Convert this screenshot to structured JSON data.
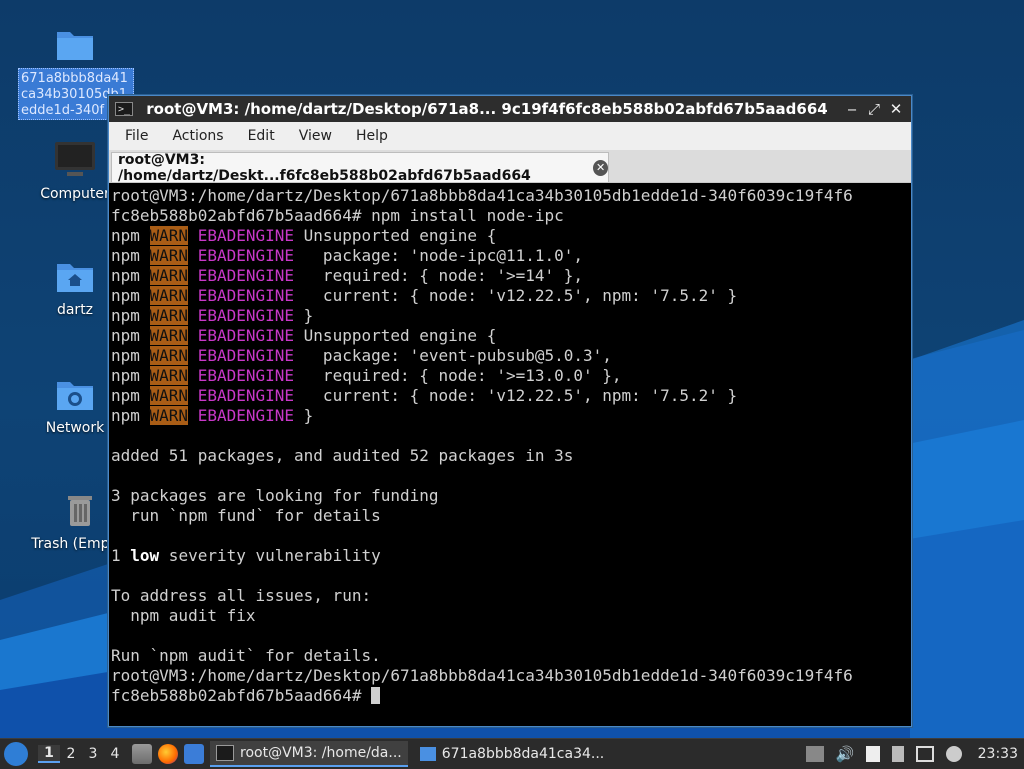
{
  "desktop": {
    "icons": [
      {
        "label": "671a8bbb8da41ca34b30105db1edde1d-340f",
        "kind": "folder",
        "selected": true
      },
      {
        "label": "Computer",
        "kind": "computer"
      },
      {
        "label": "dartz",
        "kind": "home-folder"
      },
      {
        "label": "Network",
        "kind": "network-folder"
      },
      {
        "label": "Trash (Empty)",
        "kind": "trash"
      }
    ]
  },
  "window": {
    "title": "root@VM3: /home/dartz/Desktop/671a8... 9c19f4f6fc8eb588b02abfd67b5aad664",
    "controls": {
      "minimize": "‒",
      "maximize": "⤢",
      "close": "✕"
    },
    "menu": [
      "File",
      "Actions",
      "Edit",
      "View",
      "Help"
    ],
    "tab_label": "root@VM3: /home/dartz/Deskt...f6fc8eb588b02abfd67b5aad664",
    "terminal": {
      "prompt_1": "root@VM3:/home/dartz/Desktop/671a8bbb8da41ca34b30105db1edde1d-340f6039c19f4f6",
      "prompt_1b": "fc8eb588b02abfd67b5aad664# npm install node-ipc",
      "warn_prefix": "npm",
      "warn_tag": "WARN",
      "warn_code": "EBADENGINE",
      "warn_lines": [
        "Unsupported engine {",
        "  package: 'node-ipc@11.1.0',",
        "  required: { node: '>=14' },",
        "  current: { node: 'v12.22.5', npm: '7.5.2' }",
        "}",
        "Unsupported engine {",
        "  package: 'event-pubsub@5.0.3',",
        "  required: { node: '>=13.0.0' },",
        "  current: { node: 'v12.22.5', npm: '7.5.2' }",
        "}"
      ],
      "added": "added 51 packages, and audited 52 packages in 3s",
      "funding_1": "3 packages are looking for funding",
      "funding_2": "  run `npm fund` for details",
      "vuln_count": "1",
      "vuln_level": "low",
      "vuln_rest": " severity vulnerability",
      "address_1": "To address all issues, run:",
      "address_2": "  npm audit fix",
      "details": "Run `npm audit` for details.",
      "prompt_2": "root@VM3:/home/dartz/Desktop/671a8bbb8da41ca34b30105db1edde1d-340f6039c19f4f6",
      "prompt_2b": "fc8eb588b02abfd67b5aad664# "
    }
  },
  "taskbar": {
    "workspaces": [
      "1",
      "2",
      "3",
      "4"
    ],
    "active_workspace": "1",
    "tasks": [
      {
        "label": "root@VM3: /home/da...",
        "active": true
      },
      {
        "label": "671a8bbb8da41ca34...",
        "active": false
      }
    ],
    "clock": "23:33"
  },
  "colors": {
    "accent": "#5aa0f0",
    "warn_bg": "#a95d16",
    "ebadengine": "#c838c8"
  }
}
